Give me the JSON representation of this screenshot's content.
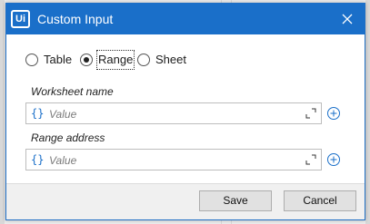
{
  "window": {
    "title": "Custom Input",
    "logo_text": "Ui"
  },
  "source_options": [
    {
      "label": "Table",
      "selected": false
    },
    {
      "label": "Range",
      "selected": true
    },
    {
      "label": "Sheet",
      "selected": false
    }
  ],
  "fields": [
    {
      "label": "Worksheet name",
      "placeholder": "Value",
      "brace": "{}"
    },
    {
      "label": "Range address",
      "placeholder": "Value",
      "brace": "{}"
    }
  ],
  "footer": {
    "save_label": "Save",
    "cancel_label": "Cancel"
  },
  "colors": {
    "accent": "#1a6fc9"
  },
  "icons": {
    "close": "close-icon",
    "expand": "expand-icon",
    "add": "plus-circle-icon"
  }
}
